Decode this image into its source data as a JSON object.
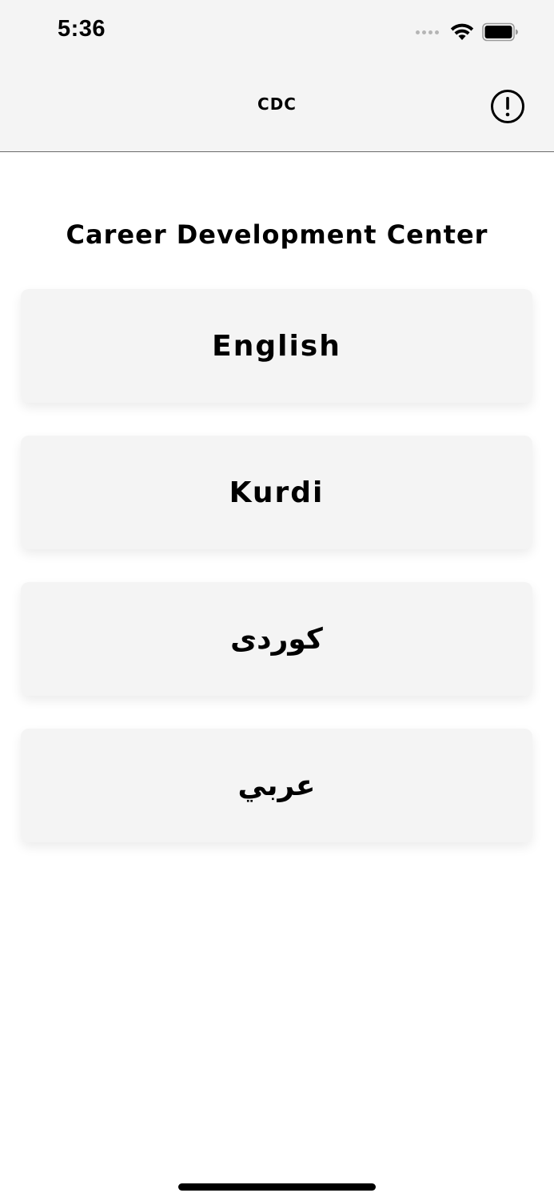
{
  "status_bar": {
    "time": "5:36"
  },
  "nav": {
    "title": "CDC",
    "info_icon": "exclamation-circle-icon"
  },
  "main": {
    "heading": "Career Development Center",
    "languages": [
      {
        "label": "English"
      },
      {
        "label": "Kurdi"
      },
      {
        "label": "کوردی"
      },
      {
        "label": "عربي"
      }
    ]
  },
  "colors": {
    "background": "#ffffff",
    "bar_background": "#f4f4f4",
    "button_background": "#f4f4f4",
    "text": "#000000"
  }
}
